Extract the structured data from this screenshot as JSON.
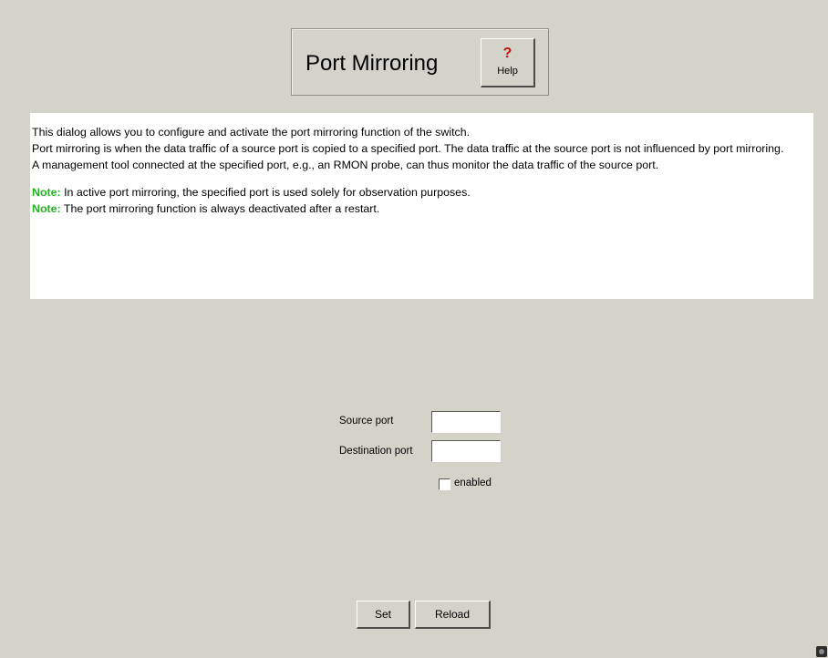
{
  "header": {
    "title": "Port Mirroring",
    "help": {
      "icon": "question-mark-icon",
      "glyph": "?",
      "label": "Help",
      "icon_color": "#c20f0f"
    }
  },
  "description": {
    "lines": [
      "This dialog allows you to configure and activate the port mirroring function of the switch.",
      "Port mirroring is when the data traffic of a source port is copied to a specified port. The data traffic at the source port is not influenced by port mirroring.",
      "A management tool connected at the specified port, e.g., an RMON probe, can thus monitor the data traffic of the source port."
    ],
    "notes": [
      {
        "label": "Note:",
        "text": " In active port mirroring, the specified port is used solely for observation purposes."
      },
      {
        "label": "Note:",
        "text": " The port mirroring function is always deactivated after a restart."
      }
    ],
    "note_color": "#21b421"
  },
  "form": {
    "source_port": {
      "label": "Source port",
      "value": ""
    },
    "destination_port": {
      "label": "Destination port",
      "value": ""
    },
    "enabled": {
      "label": "enabled",
      "checked": false
    }
  },
  "buttons": {
    "set": "Set",
    "reload": "Reload"
  },
  "colors": {
    "background": "#d4d3ca",
    "panel": "#ffffff"
  },
  "status": {
    "corner_icon": "status-indicator-icon"
  }
}
